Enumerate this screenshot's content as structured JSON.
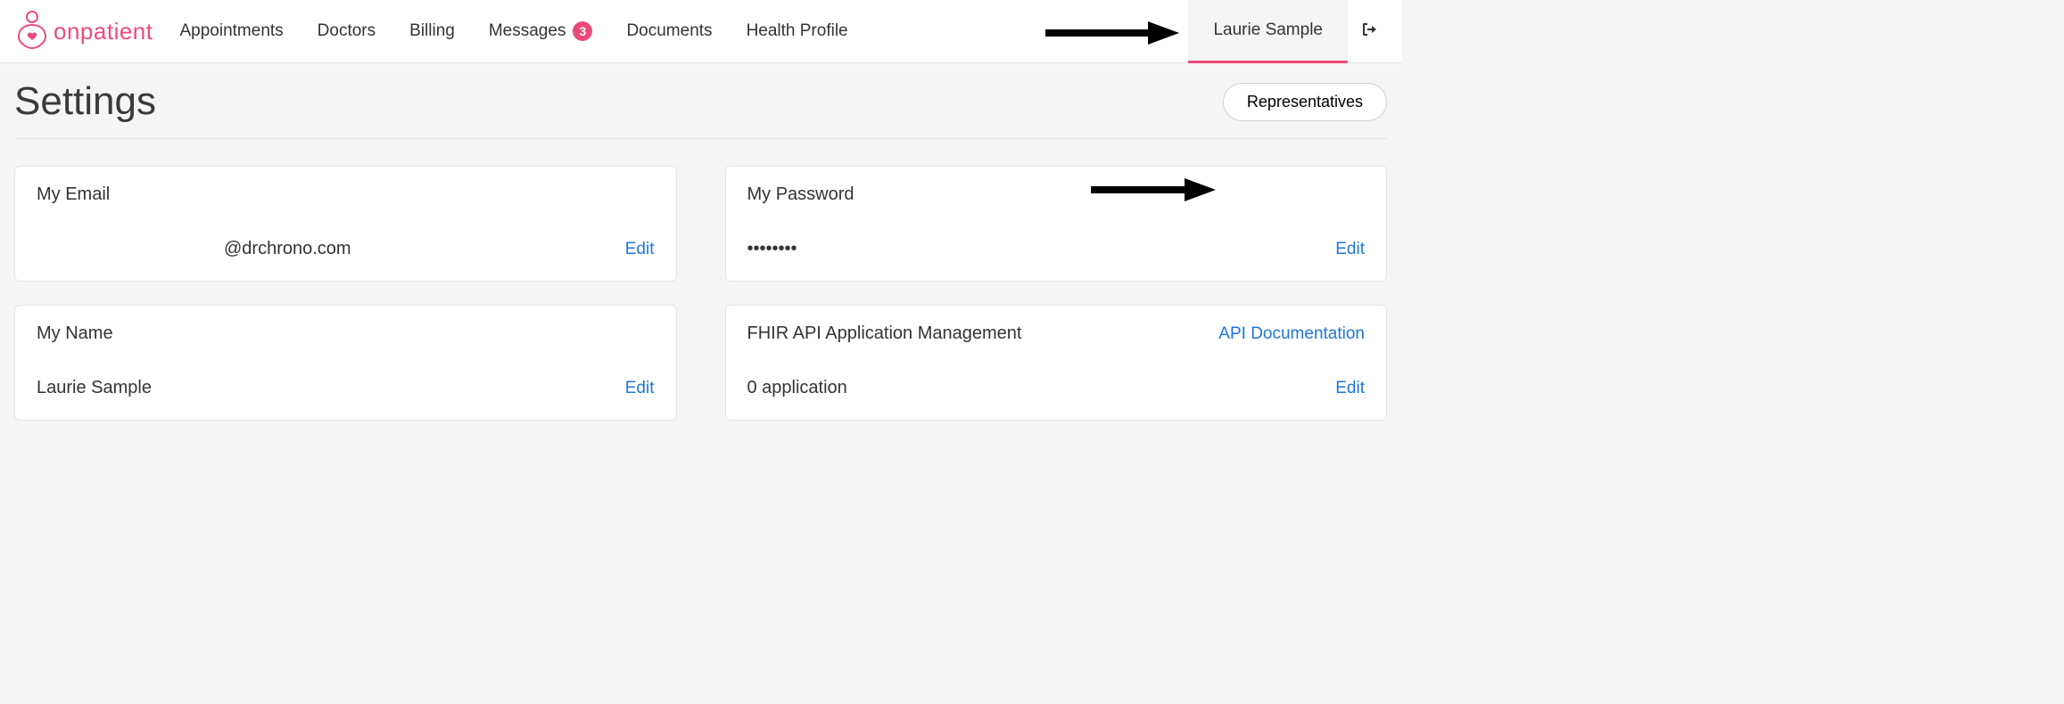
{
  "brand": {
    "name": "onpatient"
  },
  "nav": {
    "appointments": "Appointments",
    "doctors": "Doctors",
    "billing": "Billing",
    "messages": "Messages",
    "messages_count": "3",
    "documents": "Documents",
    "health_profile": "Health Profile"
  },
  "user": {
    "name": "Laurie Sample"
  },
  "page": {
    "title": "Settings",
    "representatives_btn": "Representatives"
  },
  "cards": {
    "email": {
      "title": "My Email",
      "value": "@drchrono.com",
      "edit": "Edit"
    },
    "password": {
      "title": "My Password",
      "value": "••••••••",
      "edit": "Edit"
    },
    "name": {
      "title": "My Name",
      "value": "Laurie Sample",
      "edit": "Edit"
    },
    "fhir": {
      "title": "FHIR API Application Management",
      "doc_link": "API Documentation",
      "value": "0 application",
      "edit": "Edit"
    }
  }
}
